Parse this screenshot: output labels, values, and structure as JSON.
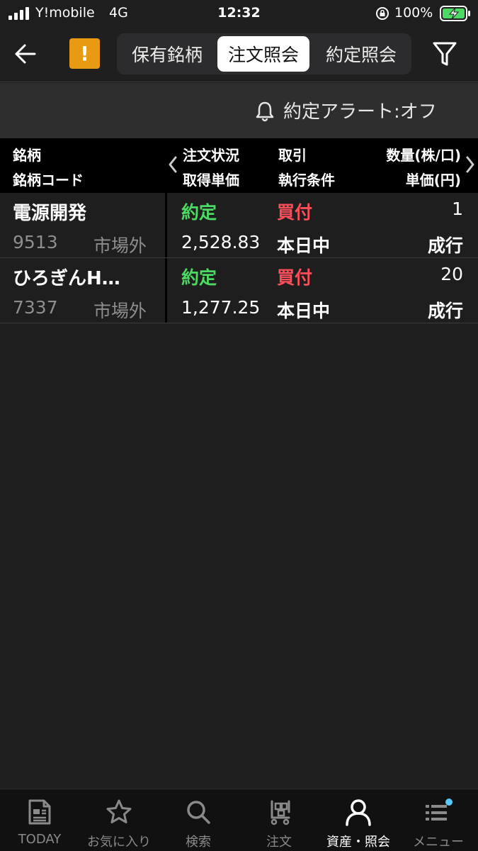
{
  "status_bar": {
    "carrier": "Y!mobile",
    "network": "4G",
    "time": "12:32",
    "battery": "100%"
  },
  "header": {
    "back_icon": "back-arrow-icon",
    "warning_label": "!",
    "tabs": [
      {
        "label": "保有銘柄",
        "active": false
      },
      {
        "label": "注文照会",
        "active": true
      },
      {
        "label": "約定照会",
        "active": false
      }
    ],
    "filter_icon": "filter-icon"
  },
  "alert": {
    "label": "約定アラート:オフ"
  },
  "table": {
    "columns": {
      "stock": "銘柄",
      "stock_code": "銘柄コード",
      "order_status": "注文状況",
      "acquisition_price": "取得単価",
      "trade": "取引",
      "execution_condition": "執行条件",
      "quantity": "数量(株/口)",
      "unit_price": "単価(円)"
    },
    "rows": [
      {
        "name": "電源開発",
        "code": "9513",
        "market": "市場外",
        "status": "約定",
        "price": "2,528.83",
        "trade": "買付",
        "condition": "本日中",
        "quantity": "1",
        "unit_price": "成行"
      },
      {
        "name": "ひろぎんH…",
        "code": "7337",
        "market": "市場外",
        "status": "約定",
        "price": "1,277.25",
        "trade": "買付",
        "condition": "本日中",
        "quantity": "20",
        "unit_price": "成行"
      }
    ]
  },
  "tabbar": {
    "items": [
      {
        "label": "TODAY",
        "icon": "news-icon",
        "active": false
      },
      {
        "label": "お気に入り",
        "icon": "star-icon",
        "active": false
      },
      {
        "label": "検索",
        "icon": "search-icon",
        "active": false
      },
      {
        "label": "注文",
        "icon": "cart-icon",
        "active": false
      },
      {
        "label": "資産・照会",
        "icon": "person-icon",
        "active": true
      },
      {
        "label": "メニュー",
        "icon": "menu-icon",
        "active": false
      }
    ]
  },
  "colors": {
    "accent_green": "#4cd964",
    "accent_red": "#ff4d5a",
    "warning_orange": "#e89a12",
    "notification_dot": "#5ac8fa"
  }
}
